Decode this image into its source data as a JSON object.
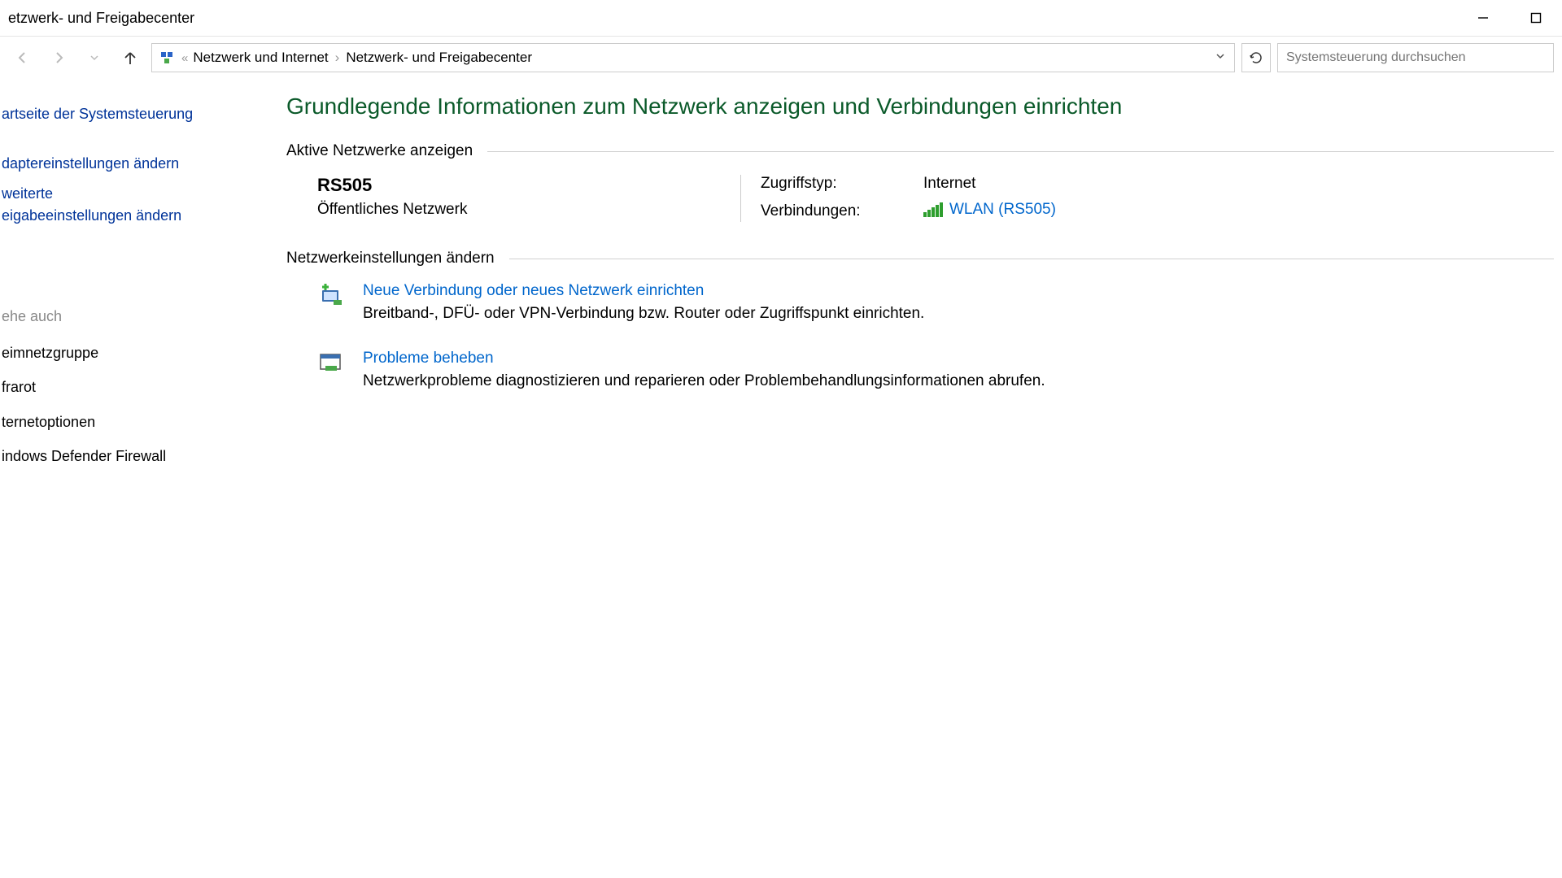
{
  "window": {
    "title": "etzwerk- und Freigabecenter"
  },
  "breadcrumb": {
    "parent": "Netzwerk und Internet",
    "current": "Netzwerk- und Freigabecenter"
  },
  "search": {
    "placeholder": "Systemsteuerung durchsuchen"
  },
  "sidebar": {
    "homeLink": "artseite der Systemsteuerung",
    "links": [
      "daptereinstellungen ändern",
      "weiterte\neigabeeinstellungen ändern"
    ],
    "seeAlsoHeading": "ehe auch",
    "seeAlsoItems": [
      "eimnetzgruppe",
      "frarot",
      "ternetoptionen",
      "indows Defender Firewall"
    ]
  },
  "main": {
    "heading": "Grundlegende Informationen zum Netzwerk anzeigen und Verbindungen einrichten",
    "activeNetworksTitle": "Aktive Netzwerke anzeigen",
    "network": {
      "name": "RS505",
      "type": "Öffentliches Netzwerk",
      "accessTypeLabel": "Zugriffstyp:",
      "accessTypeValue": "Internet",
      "connectionsLabel": "Verbindungen:",
      "connectionsValue": "WLAN (RS505)"
    },
    "changeSettingsTitle": "Netzwerkeinstellungen ändern",
    "tasks": [
      {
        "title": "Neue Verbindung oder neues Netzwerk einrichten",
        "desc": "Breitband-, DFÜ- oder VPN-Verbindung bzw. Router oder Zugriffspunkt einrichten."
      },
      {
        "title": "Probleme beheben",
        "desc": "Netzwerkprobleme diagnostizieren und reparieren oder Problembehandlungsinformationen abrufen."
      }
    ]
  }
}
